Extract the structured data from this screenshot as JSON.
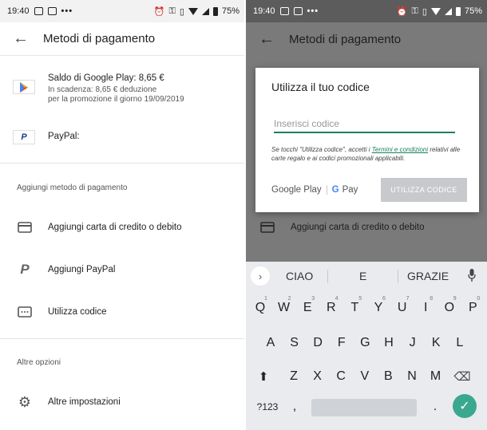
{
  "left": {
    "status": {
      "time": "19:40",
      "battery": "75%"
    },
    "appbar": {
      "title": "Metodi di pagamento"
    },
    "methods": [
      {
        "name": "Saldo di Google Play: 8,65 €",
        "sub1": "In scadenza: 8,65 € deduzione",
        "sub2": "per la promozione il giorno 19/09/2019",
        "icon": "google-play-icon"
      },
      {
        "name": "PayPal:",
        "icon": "paypal-icon"
      }
    ],
    "add_section_label": "Aggiungi metodo di pagamento",
    "add_items": [
      {
        "label": "Aggiungi carta di credito o debito",
        "icon": "credit-card-icon"
      },
      {
        "label": "Aggiungi PayPal",
        "icon": "paypal-icon"
      },
      {
        "label": "Utilizza codice",
        "icon": "code-icon"
      }
    ],
    "other_section_label": "Altre opzioni",
    "other_items": [
      {
        "label": "Altre impostazioni",
        "icon": "gear-icon"
      }
    ]
  },
  "right": {
    "status": {
      "time": "19:40",
      "battery": "75%"
    },
    "appbar": {
      "title": "Metodi di pagamento"
    },
    "dialog": {
      "title": "Utilizza il tuo codice",
      "input_placeholder": "Inserisci codice",
      "legal_before": "Se tocchi \"Utilizza codice\", accetti i ",
      "legal_link": "Termini e condizioni",
      "legal_after": " relativi alle carte regalo e ai codici promozionali applicabili.",
      "brand_google_play": "Google Play",
      "brand_gpay_g": "G",
      "brand_gpay": "Pay",
      "button": "UTILIZZA CODICE"
    },
    "bg_row": "Aggiungi carta di credito o debito",
    "keyboard": {
      "suggestions": [
        "CIAO",
        "E",
        "GRAZIE"
      ],
      "row1": [
        "Q",
        "W",
        "E",
        "R",
        "T",
        "Y",
        "U",
        "I",
        "O",
        "P"
      ],
      "row1_hints": [
        "1",
        "2",
        "3",
        "4",
        "5",
        "6",
        "7",
        "8",
        "9",
        "0"
      ],
      "row2": [
        "A",
        "S",
        "D",
        "F",
        "G",
        "H",
        "J",
        "K",
        "L"
      ],
      "row3": [
        "Z",
        "X",
        "C",
        "V",
        "B",
        "N",
        "M"
      ],
      "sym_key": "?123",
      "comma_key": ",",
      "period_key": "."
    }
  }
}
